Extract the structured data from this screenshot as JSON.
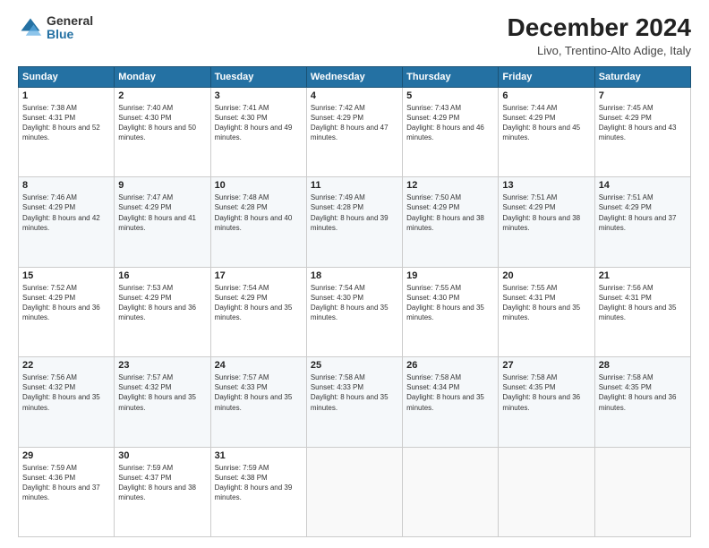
{
  "logo": {
    "general": "General",
    "blue": "Blue"
  },
  "header": {
    "title": "December 2024",
    "subtitle": "Livo, Trentino-Alto Adige, Italy"
  },
  "weekdays": [
    "Sunday",
    "Monday",
    "Tuesday",
    "Wednesday",
    "Thursday",
    "Friday",
    "Saturday"
  ],
  "weeks": [
    [
      {
        "day": "1",
        "info": "Sunrise: 7:38 AM\nSunset: 4:31 PM\nDaylight: 8 hours and 52 minutes."
      },
      {
        "day": "2",
        "info": "Sunrise: 7:40 AM\nSunset: 4:30 PM\nDaylight: 8 hours and 50 minutes."
      },
      {
        "day": "3",
        "info": "Sunrise: 7:41 AM\nSunset: 4:30 PM\nDaylight: 8 hours and 49 minutes."
      },
      {
        "day": "4",
        "info": "Sunrise: 7:42 AM\nSunset: 4:29 PM\nDaylight: 8 hours and 47 minutes."
      },
      {
        "day": "5",
        "info": "Sunrise: 7:43 AM\nSunset: 4:29 PM\nDaylight: 8 hours and 46 minutes."
      },
      {
        "day": "6",
        "info": "Sunrise: 7:44 AM\nSunset: 4:29 PM\nDaylight: 8 hours and 45 minutes."
      },
      {
        "day": "7",
        "info": "Sunrise: 7:45 AM\nSunset: 4:29 PM\nDaylight: 8 hours and 43 minutes."
      }
    ],
    [
      {
        "day": "8",
        "info": "Sunrise: 7:46 AM\nSunset: 4:29 PM\nDaylight: 8 hours and 42 minutes."
      },
      {
        "day": "9",
        "info": "Sunrise: 7:47 AM\nSunset: 4:29 PM\nDaylight: 8 hours and 41 minutes."
      },
      {
        "day": "10",
        "info": "Sunrise: 7:48 AM\nSunset: 4:28 PM\nDaylight: 8 hours and 40 minutes."
      },
      {
        "day": "11",
        "info": "Sunrise: 7:49 AM\nSunset: 4:28 PM\nDaylight: 8 hours and 39 minutes."
      },
      {
        "day": "12",
        "info": "Sunrise: 7:50 AM\nSunset: 4:29 PM\nDaylight: 8 hours and 38 minutes."
      },
      {
        "day": "13",
        "info": "Sunrise: 7:51 AM\nSunset: 4:29 PM\nDaylight: 8 hours and 38 minutes."
      },
      {
        "day": "14",
        "info": "Sunrise: 7:51 AM\nSunset: 4:29 PM\nDaylight: 8 hours and 37 minutes."
      }
    ],
    [
      {
        "day": "15",
        "info": "Sunrise: 7:52 AM\nSunset: 4:29 PM\nDaylight: 8 hours and 36 minutes."
      },
      {
        "day": "16",
        "info": "Sunrise: 7:53 AM\nSunset: 4:29 PM\nDaylight: 8 hours and 36 minutes."
      },
      {
        "day": "17",
        "info": "Sunrise: 7:54 AM\nSunset: 4:29 PM\nDaylight: 8 hours and 35 minutes."
      },
      {
        "day": "18",
        "info": "Sunrise: 7:54 AM\nSunset: 4:30 PM\nDaylight: 8 hours and 35 minutes."
      },
      {
        "day": "19",
        "info": "Sunrise: 7:55 AM\nSunset: 4:30 PM\nDaylight: 8 hours and 35 minutes."
      },
      {
        "day": "20",
        "info": "Sunrise: 7:55 AM\nSunset: 4:31 PM\nDaylight: 8 hours and 35 minutes."
      },
      {
        "day": "21",
        "info": "Sunrise: 7:56 AM\nSunset: 4:31 PM\nDaylight: 8 hours and 35 minutes."
      }
    ],
    [
      {
        "day": "22",
        "info": "Sunrise: 7:56 AM\nSunset: 4:32 PM\nDaylight: 8 hours and 35 minutes."
      },
      {
        "day": "23",
        "info": "Sunrise: 7:57 AM\nSunset: 4:32 PM\nDaylight: 8 hours and 35 minutes."
      },
      {
        "day": "24",
        "info": "Sunrise: 7:57 AM\nSunset: 4:33 PM\nDaylight: 8 hours and 35 minutes."
      },
      {
        "day": "25",
        "info": "Sunrise: 7:58 AM\nSunset: 4:33 PM\nDaylight: 8 hours and 35 minutes."
      },
      {
        "day": "26",
        "info": "Sunrise: 7:58 AM\nSunset: 4:34 PM\nDaylight: 8 hours and 35 minutes."
      },
      {
        "day": "27",
        "info": "Sunrise: 7:58 AM\nSunset: 4:35 PM\nDaylight: 8 hours and 36 minutes."
      },
      {
        "day": "28",
        "info": "Sunrise: 7:58 AM\nSunset: 4:35 PM\nDaylight: 8 hours and 36 minutes."
      }
    ],
    [
      {
        "day": "29",
        "info": "Sunrise: 7:59 AM\nSunset: 4:36 PM\nDaylight: 8 hours and 37 minutes."
      },
      {
        "day": "30",
        "info": "Sunrise: 7:59 AM\nSunset: 4:37 PM\nDaylight: 8 hours and 38 minutes."
      },
      {
        "day": "31",
        "info": "Sunrise: 7:59 AM\nSunset: 4:38 PM\nDaylight: 8 hours and 39 minutes."
      },
      null,
      null,
      null,
      null
    ]
  ]
}
